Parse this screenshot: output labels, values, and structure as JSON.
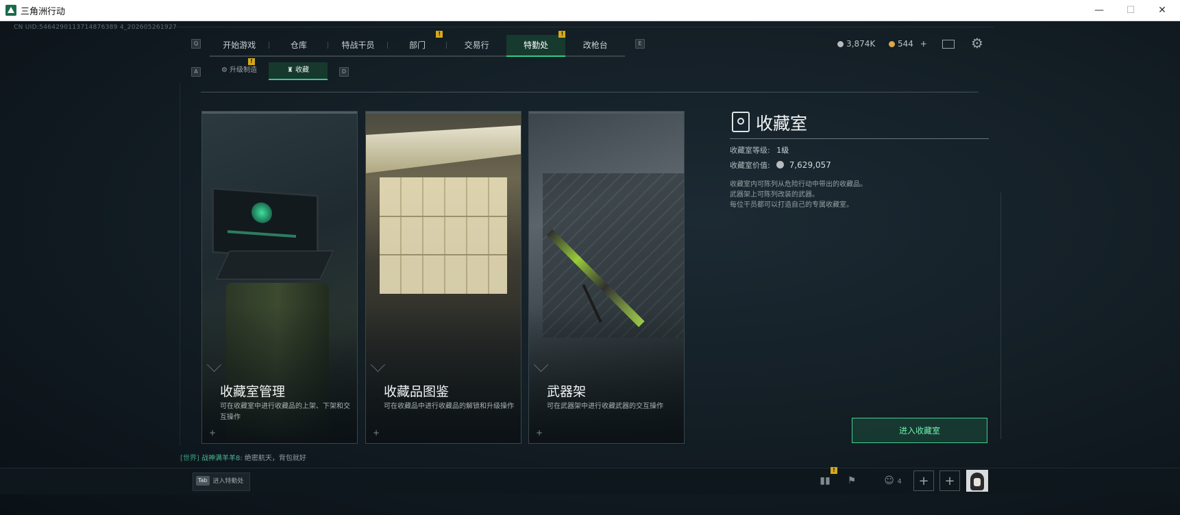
{
  "window": {
    "title": "三角洲行动",
    "minimize_glyph": "—",
    "maximize_glyph": "☐",
    "close_glyph": "✕"
  },
  "uid": "CN UID:5464290113714876389 4_202605261927",
  "nav": {
    "left_key": "Q",
    "right_key": "E",
    "tabs": [
      {
        "label": "开始游戏",
        "badge": ""
      },
      {
        "label": "仓库",
        "badge": ""
      },
      {
        "label": "特战干员",
        "badge": ""
      },
      {
        "label": "部门",
        "badge": "!"
      },
      {
        "label": "交易行",
        "badge": ""
      },
      {
        "label": "特勤处",
        "badge": "!",
        "active": true
      },
      {
        "label": "改枪台",
        "badge": ""
      }
    ]
  },
  "subnav": {
    "left_key": "A",
    "right_key": "D",
    "tabs": [
      {
        "label": "升级制造",
        "badge": "!"
      },
      {
        "label": "收藏",
        "active": true
      }
    ]
  },
  "currency": {
    "silver": "3,874K",
    "gold": "544",
    "plus": "+",
    "silver_color": "#b8bcbf",
    "gold_color": "#d9a94a"
  },
  "cards": [
    {
      "title": "收藏室管理",
      "desc": "可在收藏室中进行收藏品的上架、下架和交互操作",
      "icon": "expand-icon"
    },
    {
      "title": "收藏品图鉴",
      "desc": "可在收藏品中进行收藏品的解锁和升级操作",
      "icon": "expand-icon"
    },
    {
      "title": "武器架",
      "desc": "可在武器架中进行收藏武器的交互操作",
      "icon": "expand-icon"
    }
  ],
  "info": {
    "title": "收藏室",
    "level_label": "收藏室等级:",
    "level_value": "1级",
    "value_label": "收藏室价值:",
    "value_amount": "7,629,057",
    "desc_lines": [
      "收藏室内可陈列从危险行动中带出的收藏品。",
      "武器架上可陈列改装的武器。",
      "每位干员都可以打造自己的专属收藏室。"
    ],
    "enter_button": "进入收藏室"
  },
  "chat": {
    "channel": "[世界]",
    "user": "战神满羊羊8:",
    "message": "绝密航天，背包就好"
  },
  "bottom": {
    "tab_key": "Tab",
    "tab_label": "进入特勤处",
    "badge": "!",
    "friends_count": "4"
  },
  "colors": {
    "accent": "#36c98a",
    "badge": "#d6a91a",
    "background": "#121c23"
  }
}
